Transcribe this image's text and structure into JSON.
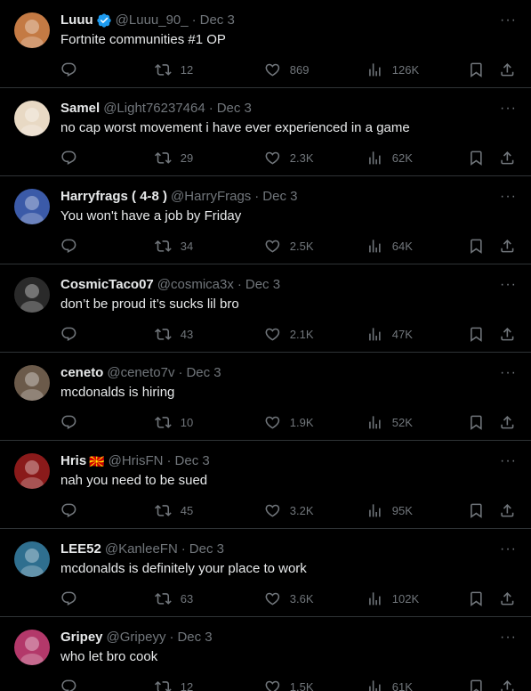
{
  "tweets": [
    {
      "name": "Luuu",
      "verified": true,
      "flag": "",
      "handle": "@Luuu_90_",
      "date": "Dec 3",
      "text": "Fortnite communities #1 OP",
      "replies": "",
      "retweets": "12",
      "likes": "869",
      "views": "126K",
      "avatar_color": "#c47a44"
    },
    {
      "name": "Samel",
      "verified": false,
      "flag": "",
      "handle": "@Light76237464",
      "date": "Dec 3",
      "text": "no cap worst movement i have ever experienced in a game",
      "replies": "",
      "retweets": "29",
      "likes": "2.3K",
      "views": "62K",
      "avatar_color": "#e8d9c4"
    },
    {
      "name": "Harryfrags ( 4-8 )",
      "verified": false,
      "flag": "",
      "handle": "@HarryFrags",
      "date": "Dec 3",
      "text": "You won't have a job by Friday",
      "replies": "",
      "retweets": "34",
      "likes": "2.5K",
      "views": "64K",
      "avatar_color": "#3b5aa8"
    },
    {
      "name": "CosmicTaco07",
      "verified": false,
      "flag": "",
      "handle": "@cosmica3x",
      "date": "Dec 3",
      "text": "don’t be proud it’s sucks lil bro",
      "replies": "",
      "retweets": "43",
      "likes": "2.1K",
      "views": "47K",
      "avatar_color": "#2a2a2a"
    },
    {
      "name": "ceneto",
      "verified": false,
      "flag": "",
      "handle": "@ceneto7v",
      "date": "Dec 3",
      "text": "mcdonalds is hiring",
      "replies": "",
      "retweets": "10",
      "likes": "1.9K",
      "views": "52K",
      "avatar_color": "#6b5a4a"
    },
    {
      "name": "Hris",
      "verified": false,
      "flag": "🇲🇰",
      "handle": "@HrisFN",
      "date": "Dec 3",
      "text": "nah you need to be sued",
      "replies": "",
      "retweets": "45",
      "likes": "3.2K",
      "views": "95K",
      "avatar_color": "#8a1a1a"
    },
    {
      "name": "LEE52",
      "verified": false,
      "flag": "",
      "handle": "@KanleeFN",
      "date": "Dec 3",
      "text": "mcdonalds is definitely your place to work",
      "replies": "",
      "retweets": "63",
      "likes": "3.6K",
      "views": "102K",
      "avatar_color": "#2f6f8f"
    },
    {
      "name": "Gripey",
      "verified": false,
      "flag": "",
      "handle": "@Gripeyy",
      "date": "Dec 3",
      "text": "who let bro cook",
      "replies": "",
      "retweets": "12",
      "likes": "1.5K",
      "views": "61K",
      "avatar_color": "#b3386a"
    }
  ],
  "more_label": "···",
  "separator": "·",
  "icons": {
    "reply": "reply-icon",
    "retweet": "retweet-icon",
    "like": "heart-icon",
    "views": "views-icon",
    "bookmark": "bookmark-icon",
    "share": "share-icon",
    "verified": "verified-badge-icon"
  },
  "colors": {
    "background": "#000000",
    "text": "#e7e9ea",
    "muted": "#71767b",
    "border": "#2f3336",
    "verified": "#1d9bf0"
  }
}
